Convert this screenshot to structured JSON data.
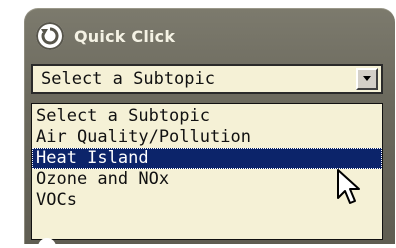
{
  "widget": {
    "title": "Quick Click",
    "icon": "arrow-circle-icon"
  },
  "select": {
    "selected_value": "Select a Subtopic",
    "arrow_icon": "chevron-down-icon"
  },
  "options": [
    {
      "label": "Select a Subtopic",
      "highlighted": false
    },
    {
      "label": "Air Quality/Pollution",
      "highlighted": false
    },
    {
      "label": "Heat Island",
      "highlighted": true
    },
    {
      "label": "Ozone and NOx",
      "highlighted": false
    },
    {
      "label": "VOCs",
      "highlighted": false
    }
  ],
  "colors": {
    "panel": "#6b695d",
    "field": "#f5f1d6",
    "highlight": "#0c246a",
    "title_text": "#f4f2e4"
  }
}
